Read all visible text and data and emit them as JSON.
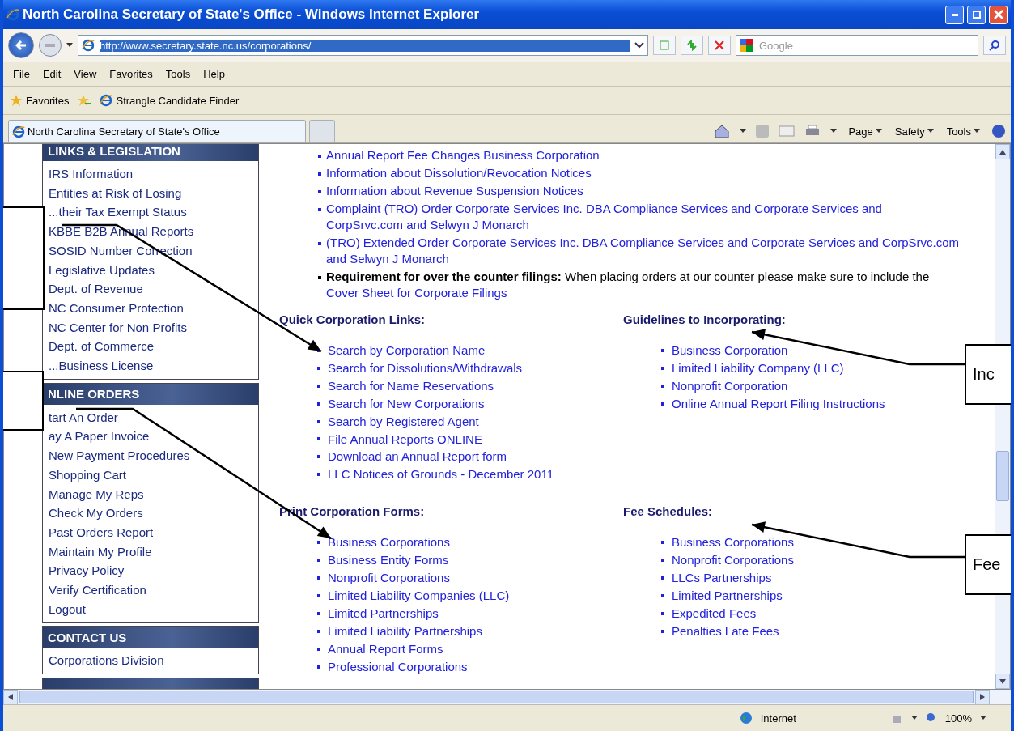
{
  "window": {
    "title": "North Carolina Secretary of State's Office - Windows Internet Explorer"
  },
  "address": {
    "url": "http://www.secretary.state.nc.us/corporations/"
  },
  "search": {
    "placeholder": "Google"
  },
  "menu": [
    "File",
    "Edit",
    "View",
    "Favorites",
    "Tools",
    "Help"
  ],
  "favorites_bar": {
    "label": "Favorites",
    "items": [
      "Strangle Candidate Finder"
    ]
  },
  "tabs": [
    {
      "label": "North Carolina Secretary of State's Office",
      "selected": true
    }
  ],
  "command_bar": [
    "Page",
    "Safety",
    "Tools"
  ],
  "sidebar": {
    "sections": [
      {
        "title": "LINKS & LEGISLATION",
        "items": [
          "IRS Information",
          "Entities at Risk of Losing",
          "...their Tax Exempt Status",
          "KBBE B2B Annual Reports",
          "SOSID Number Correction",
          "Legislative Updates",
          "Dept. of Revenue",
          "NC Consumer Protection",
          "NC Center for Non Profits",
          "Dept. of Commerce",
          "...Business License"
        ]
      },
      {
        "title": "NLINE ORDERS",
        "items": [
          "tart An Order",
          "ay A Paper Invoice",
          "New Payment Procedures",
          "Shopping Cart",
          "Manage My Reps",
          "Check My Orders",
          "Past Orders Report",
          "Maintain My Profile",
          "Privacy Policy",
          "Verify Certification",
          "Logout"
        ]
      },
      {
        "title": "CONTACT US",
        "items": [
          "Corporations Division"
        ]
      }
    ]
  },
  "notices": [
    {
      "kind": "link",
      "text": "Annual Report Fee Changes Business Corporation"
    },
    {
      "kind": "link",
      "text": "Information about Dissolution/Revocation Notices"
    },
    {
      "kind": "link",
      "text": "Information about Revenue Suspension Notices"
    },
    {
      "kind": "link",
      "text": "Complaint (TRO) Order Corporate Services Inc. DBA Compliance Services and Corporate Services and CorpSrvc.com and Selwyn J Monarch"
    },
    {
      "kind": "link",
      "text": "(TRO) Extended Order Corporate Services Inc. DBA Compliance Services and Corporate Services and CorpSrvc.com and Selwyn J Monarch"
    },
    {
      "kind": "note",
      "lead": "Requirement for over the counter filings:",
      "text": "When placing orders at our counter please make sure to include the",
      "link": "Cover Sheet for Corporate Filings"
    }
  ],
  "sections": [
    {
      "title": "Quick Corporation Links:",
      "links": [
        "Search by Corporation Name",
        "Search for Dissolutions/Withdrawals",
        "Search for Name Reservations",
        "Search for New Corporations",
        "Search by Registered Agent",
        "File Annual Reports ONLINE",
        "Download an Annual Report form",
        "LLC Notices of Grounds - December 2011"
      ]
    },
    {
      "title": "Guidelines to Incorporating:",
      "links": [
        "Business Corporation",
        "Limited Liability Company (LLC)",
        "Nonprofit Corporation",
        "Online Annual Report Filing Instructions"
      ]
    },
    {
      "title": "Print Corporation Forms:",
      "links": [
        "Business Corporations",
        "Business Entity Forms",
        "Nonprofit Corporations",
        "Limited Liability Companies (LLC)",
        "Limited Partnerships",
        "Limited Liability Partnerships",
        "Annual Report Forms",
        "Professional Corporations"
      ]
    },
    {
      "title": "Fee Schedules:",
      "links": [
        "Business Corporations",
        "Nonprofit Corporations",
        "LLCs Partnerships",
        "Limited Partnerships",
        "Expedited Fees",
        "Penalties Late Fees"
      ]
    }
  ],
  "status_bar": {
    "zone": "Internet",
    "zoom": "100%"
  },
  "callouts": [
    {
      "kind": "left"
    },
    {
      "kind": "left"
    },
    {
      "kind": "right",
      "text": "Inc"
    },
    {
      "kind": "right",
      "text": "Fee"
    }
  ]
}
